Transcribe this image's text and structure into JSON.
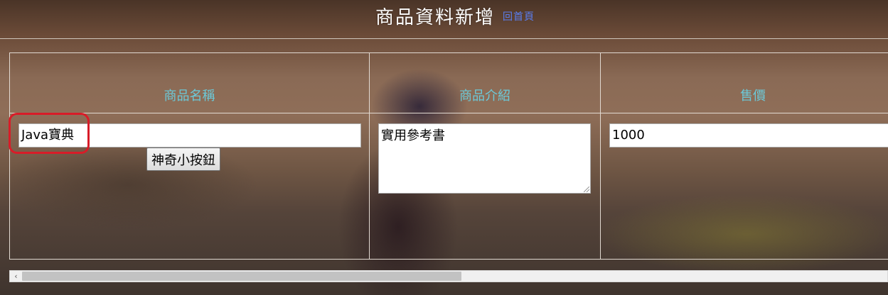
{
  "header": {
    "title": "商品資料新增",
    "back_link": "回首頁"
  },
  "table": {
    "columns": [
      "商品名稱",
      "商品介紹",
      "售價"
    ]
  },
  "form": {
    "name_value": "Java寶典",
    "magic_button_label": "神奇小按鈕",
    "description_value": "實用參考書",
    "price_value": "1000"
  },
  "colors": {
    "header_text": "#6cc9d8",
    "link": "#5a7ef0",
    "highlight": "#d81c28"
  },
  "scrollbar": {
    "left_arrow": "‹"
  }
}
